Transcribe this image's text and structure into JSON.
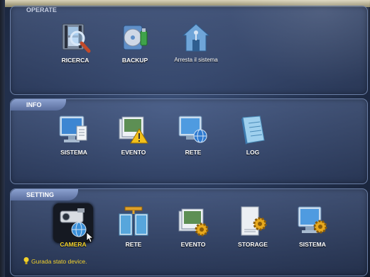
{
  "sections": {
    "operate": {
      "title": "OPERATE",
      "items": [
        {
          "label": "RICERCA",
          "icon": "search-video-icon"
        },
        {
          "label": "BACKUP",
          "icon": "backup-disc-icon"
        },
        {
          "label": "Arresta il sistema",
          "icon": "shutdown-house-icon"
        }
      ]
    },
    "info": {
      "title": "INFO",
      "items": [
        {
          "label": "SISTEMA",
          "icon": "monitor-document-icon"
        },
        {
          "label": "EVENTO",
          "icon": "event-warning-icon"
        },
        {
          "label": "RETE",
          "icon": "network-globe-icon"
        },
        {
          "label": "LOG",
          "icon": "log-book-icon"
        }
      ]
    },
    "setting": {
      "title": "SETTING",
      "items": [
        {
          "label": "CAMERA",
          "icon": "camera-globe-icon",
          "selected": true
        },
        {
          "label": "RETE",
          "icon": "network-config-icon"
        },
        {
          "label": "EVENTO",
          "icon": "event-gear-icon"
        },
        {
          "label": "STORAGE",
          "icon": "storage-gear-icon"
        },
        {
          "label": "SISTEMA",
          "icon": "system-gear-icon"
        }
      ]
    }
  },
  "status_hint": "Gurada stato device.",
  "colors": {
    "highlight": "#f3d22a",
    "panel_border": "#6b7fa6",
    "background": "#263554"
  }
}
